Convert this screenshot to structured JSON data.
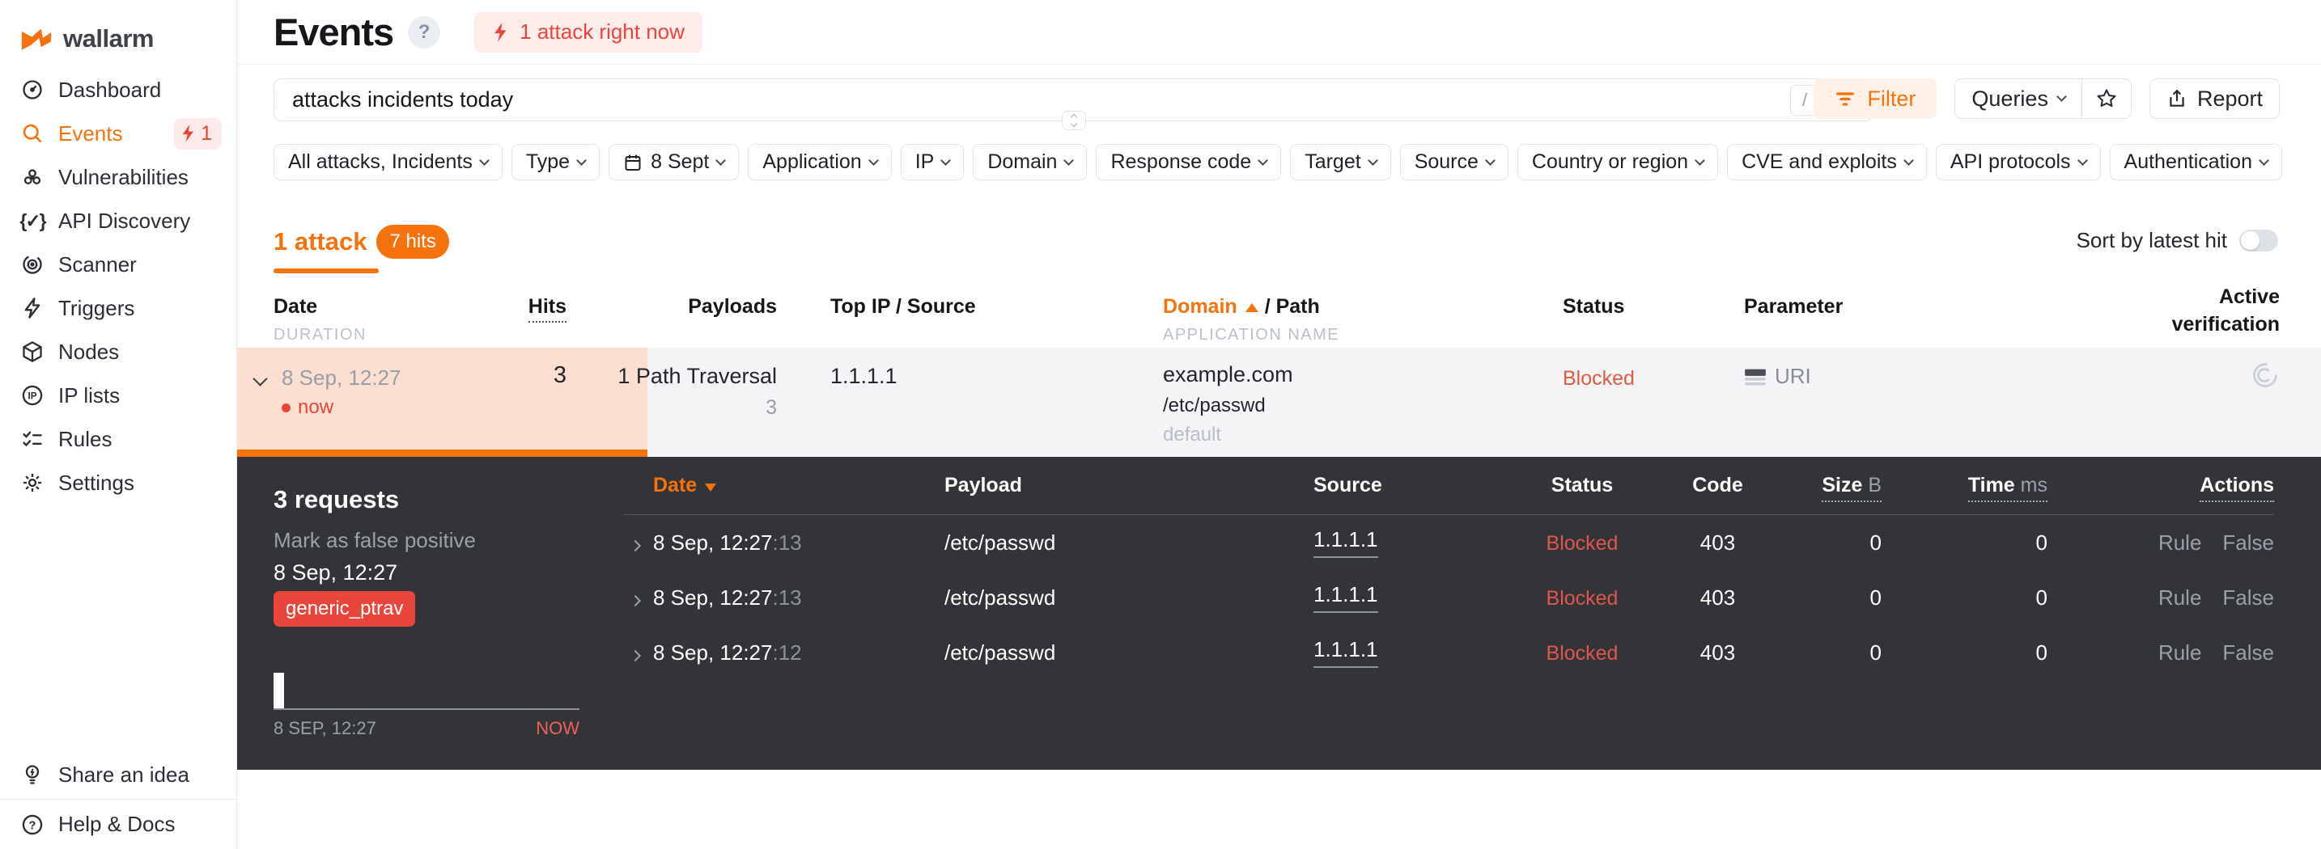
{
  "brand": {
    "name": "wallarm"
  },
  "sidebar": {
    "items": [
      {
        "label": "Dashboard"
      },
      {
        "label": "Events",
        "badge": "1"
      },
      {
        "label": "Vulnerabilities"
      },
      {
        "label": "API Discovery"
      },
      {
        "label": "Scanner"
      },
      {
        "label": "Triggers"
      },
      {
        "label": "Nodes"
      },
      {
        "label": "IP lists"
      },
      {
        "label": "Rules"
      },
      {
        "label": "Settings"
      }
    ],
    "footer": [
      {
        "label": "Share an idea"
      },
      {
        "label": "Help & Docs"
      }
    ]
  },
  "header": {
    "title": "Events",
    "help": "?",
    "alert": "1 attack right now"
  },
  "search": {
    "value": "attacks incidents today",
    "shortcut": "/"
  },
  "toolbar": {
    "filter": "Filter",
    "queries": "Queries",
    "report": "Report"
  },
  "filters": {
    "chips": [
      "All attacks, Incidents",
      "Type",
      "8 Sept",
      "Application",
      "IP",
      "Domain",
      "Response code",
      "Target",
      "Source",
      "Country or region",
      "CVE and exploits",
      "API protocols",
      "Authentication"
    ]
  },
  "summary": {
    "attacks": "1 attack",
    "hits": "7 hits",
    "sort_label": "Sort by latest hit"
  },
  "attacks_table": {
    "headers": {
      "date": "Date",
      "duration_sub": "DURATION",
      "hits": "Hits",
      "payloads": "Payloads",
      "top_ip": "Top IP / Source",
      "domain": "Domain",
      "domain_suffix": "/ Path",
      "app_sub": "APPLICATION NAME",
      "status": "Status",
      "parameter": "Parameter",
      "active_verification": "Active verification"
    },
    "row": {
      "date": "8 Sep, 12:27",
      "duration": "now",
      "hits": "3",
      "payload": "1 Path Traversal",
      "payload_count": "3",
      "top_ip": "1.1.1.1",
      "domain": "example.com",
      "path": "/etc/passwd",
      "application": "default",
      "status": "Blocked",
      "parameter": "URI"
    }
  },
  "details": {
    "title": "3 requests",
    "mark_false_positive": "Mark as false positive",
    "date": "8 Sep, 12:27",
    "tag": "generic_ptrav",
    "timeline": {
      "start": "8 SEP, 12:27",
      "end": "NOW",
      "bars": [
        {
          "time": "8 Sep, 12:27",
          "requests": 3
        }
      ]
    },
    "table": {
      "headers": {
        "date": "Date",
        "payload": "Payload",
        "source": "Source",
        "status": "Status",
        "code": "Code",
        "size": "Size",
        "size_unit": "B",
        "time": "Time",
        "time_unit": "ms",
        "actions": "Actions"
      },
      "rows": [
        {
          "date": "8 Sep, 12:27",
          "seconds": ":13",
          "payload": "/etc/passwd",
          "source": "1.1.1.1",
          "status": "Blocked",
          "code": "403",
          "size": "0",
          "time": "0",
          "action_rule": "Rule",
          "action_false": "False"
        },
        {
          "date": "8 Sep, 12:27",
          "seconds": ":13",
          "payload": "/etc/passwd",
          "source": "1.1.1.1",
          "status": "Blocked",
          "code": "403",
          "size": "0",
          "time": "0",
          "action_rule": "Rule",
          "action_false": "False"
        },
        {
          "date": "8 Sep, 12:27",
          "seconds": ":12",
          "payload": "/etc/passwd",
          "source": "1.1.1.1",
          "status": "Blocked",
          "code": "403",
          "size": "0",
          "time": "0",
          "action_rule": "Rule",
          "action_false": "False"
        }
      ]
    }
  },
  "colors": {
    "accent": "#f6720c",
    "danger": "#e8463a",
    "panel_bg": "#333437",
    "row_highlight": "#fcdfd0"
  }
}
